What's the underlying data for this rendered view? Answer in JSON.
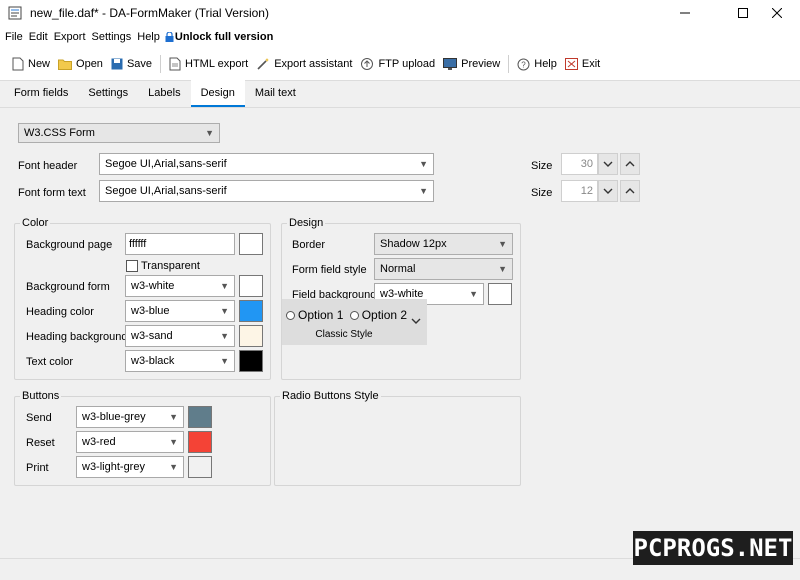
{
  "window": {
    "title": "new_file.daf* - DA-FormMaker (Trial Version)",
    "minimize": "—",
    "maximize": "☐",
    "close": "✕"
  },
  "menu": {
    "items": [
      "File",
      "Edit",
      "Export",
      "Settings",
      "Help"
    ],
    "unlock": "Unlock full version"
  },
  "toolbar": {
    "new": "New",
    "open": "Open",
    "save": "Save",
    "html_export": "HTML export",
    "export_assistant": "Export assistant",
    "ftp_upload": "FTP upload",
    "preview": "Preview",
    "help": "Help",
    "exit": "Exit"
  },
  "tabs": [
    "Form fields",
    "Settings",
    "Labels",
    "Design",
    "Mail text"
  ],
  "active_tab": "Design",
  "design": {
    "template": "W3.CSS Form",
    "font_header_label": "Font header",
    "font_header": "Segoe UI,Arial,sans-serif",
    "font_text_label": "Font form text",
    "font_text": "Segoe UI,Arial,sans-serif",
    "size_label": "Size",
    "header_size": "30",
    "text_size": "12"
  },
  "color": {
    "title": "Color",
    "bg_page_label": "Background page",
    "bg_page_value": "ffffff",
    "transparent_label": "Transparent",
    "bg_form_label": "Background form",
    "bg_form_value": "w3-white",
    "heading_color_label": "Heading color",
    "heading_color_value": "w3-blue",
    "heading_bg_label": "Heading background",
    "heading_bg_value": "w3-sand",
    "text_color_label": "Text color",
    "text_color_value": "w3-black",
    "swatches": {
      "bg_page": "#ffffff",
      "bg_form": "#ffffff",
      "heading_color": "#2196f3",
      "heading_bg": "#fdf5e6",
      "text_color": "#000000"
    }
  },
  "design_group": {
    "title": "Design",
    "border_label": "Border",
    "border_value": "Shadow 12px",
    "field_style_label": "Form field style",
    "field_style_value": "Normal",
    "field_bg_label": "Field background",
    "field_bg_value": "w3-white",
    "field_bg_swatch": "#ffffff"
  },
  "buttons": {
    "title": "Buttons",
    "send_label": "Send",
    "send_value": "w3-blue-grey",
    "send_swatch": "#607d8b",
    "reset_label": "Reset",
    "reset_value": "w3-red",
    "reset_swatch": "#f44336",
    "print_label": "Print",
    "print_value": "w3-light-grey",
    "print_swatch": "#f1f1f1"
  },
  "radio_style": {
    "title": "Radio Buttons Style",
    "option1": "Option 1",
    "option2": "Option 2",
    "style_name": "Classic Style"
  },
  "watermark": "PCPROGS.NET"
}
